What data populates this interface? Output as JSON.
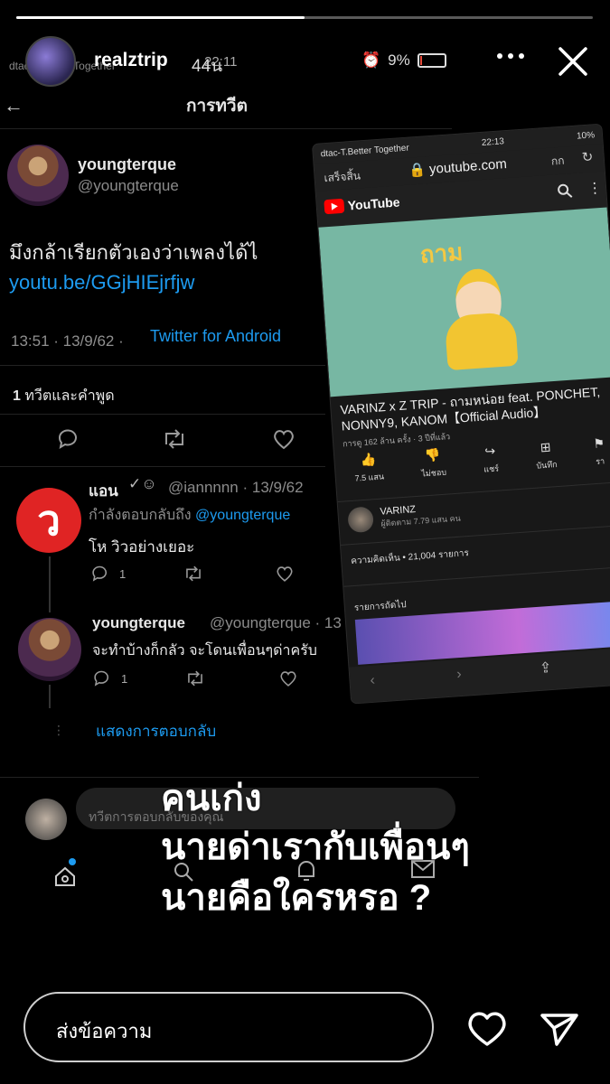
{
  "story": {
    "username": "realztrip",
    "time": "44น",
    "progress": 0.5,
    "reply_placeholder": "ส่งข้อความ"
  },
  "caption": {
    "line1": "คนเก่ง",
    "line2": "นายด่าเรากับเพื่อนๆ",
    "line3": "นายคือใครหรอ ?"
  },
  "twitter": {
    "status_carrier": "dtac-T.Better Together",
    "status_time": "22:11",
    "status_battery": "9%",
    "header_title": "การทวีต",
    "tweet": {
      "name": "youngterque",
      "handle": "@youngterque",
      "text": "มึงกล้าเรียกตัวเองว่าเพลงได้ไ",
      "link": "youtu.be/GGjHIEjrfjw",
      "time_date": "13:51 · 13/9/62 ·",
      "client": "Twitter for Android",
      "quote_count": "1",
      "quote_label": "ทวีตและคำพูด"
    },
    "reply1": {
      "name": "แอน",
      "handle": "@iannnnn · 13/9/62",
      "replying_label": "กำลังตอบกลับถึง",
      "replying_to": "@youngterque",
      "text": "โห วิวอย่างเยอะ",
      "reply_count": "1"
    },
    "reply2": {
      "name": "youngterque",
      "handle": "@youngterque · 13",
      "text": "จะทำบ้างก็กลัว จะโดนเพื่อนๆด่าครับ",
      "reply_count": "1"
    },
    "show_replies": "แสดงการตอบกลับ",
    "compose_placeholder": "ทวีตการตอบกลับของคุณ"
  },
  "youtube": {
    "carrier": "dtac-T.Better Together",
    "time": "22:13",
    "battery": "10%",
    "done": "เสร็จสิ้น",
    "host": "youtube.com",
    "text_size": "กก",
    "logo": "YouTube",
    "art_text": "ถาม",
    "video_title": "VARINZ x Z TRIP - ถามหน่อย feat. PONCHET, NONNY9, KANOM【Official Audio】",
    "views": "การดู 162 ล้าน ครั้ง · 3 ปีที่แล้ว",
    "actions": [
      {
        "icon": "👍",
        "label": "7.5 แสน"
      },
      {
        "icon": "👎",
        "label": "ไม่ชอบ"
      },
      {
        "icon": "↪",
        "label": "แชร์"
      },
      {
        "icon": "⊞",
        "label": "บันทึก"
      },
      {
        "icon": "⚑",
        "label": "รา"
      }
    ],
    "channel_name": "VARINZ",
    "channel_subs": "ผู้ติดตาม 7.79 แสน คน",
    "comments": "ความคิดเห็น • 21,004 รายการ",
    "up_next": "รายการถัดไป"
  },
  "colors": {
    "twitter_blue": "#1d9bf0",
    "yt_red": "#ff0000",
    "anan_red": "#e02424"
  }
}
